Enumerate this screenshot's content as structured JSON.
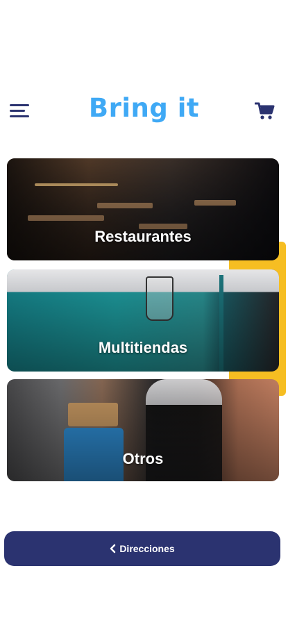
{
  "header": {
    "logo_text": "Bring it",
    "menu_icon": "hamburger-menu-icon",
    "cart_icon": "shopping-cart-icon"
  },
  "categories": [
    {
      "label": "Restaurantes"
    },
    {
      "label": "Multitiendas"
    },
    {
      "label": "Otros"
    }
  ],
  "footer": {
    "directions_label": "Direcciones",
    "directions_icon": "chevron-left-icon"
  },
  "colors": {
    "brand_blue": "#3fa9f5",
    "navy": "#2b3370",
    "accent_yellow": "#f6be22"
  }
}
